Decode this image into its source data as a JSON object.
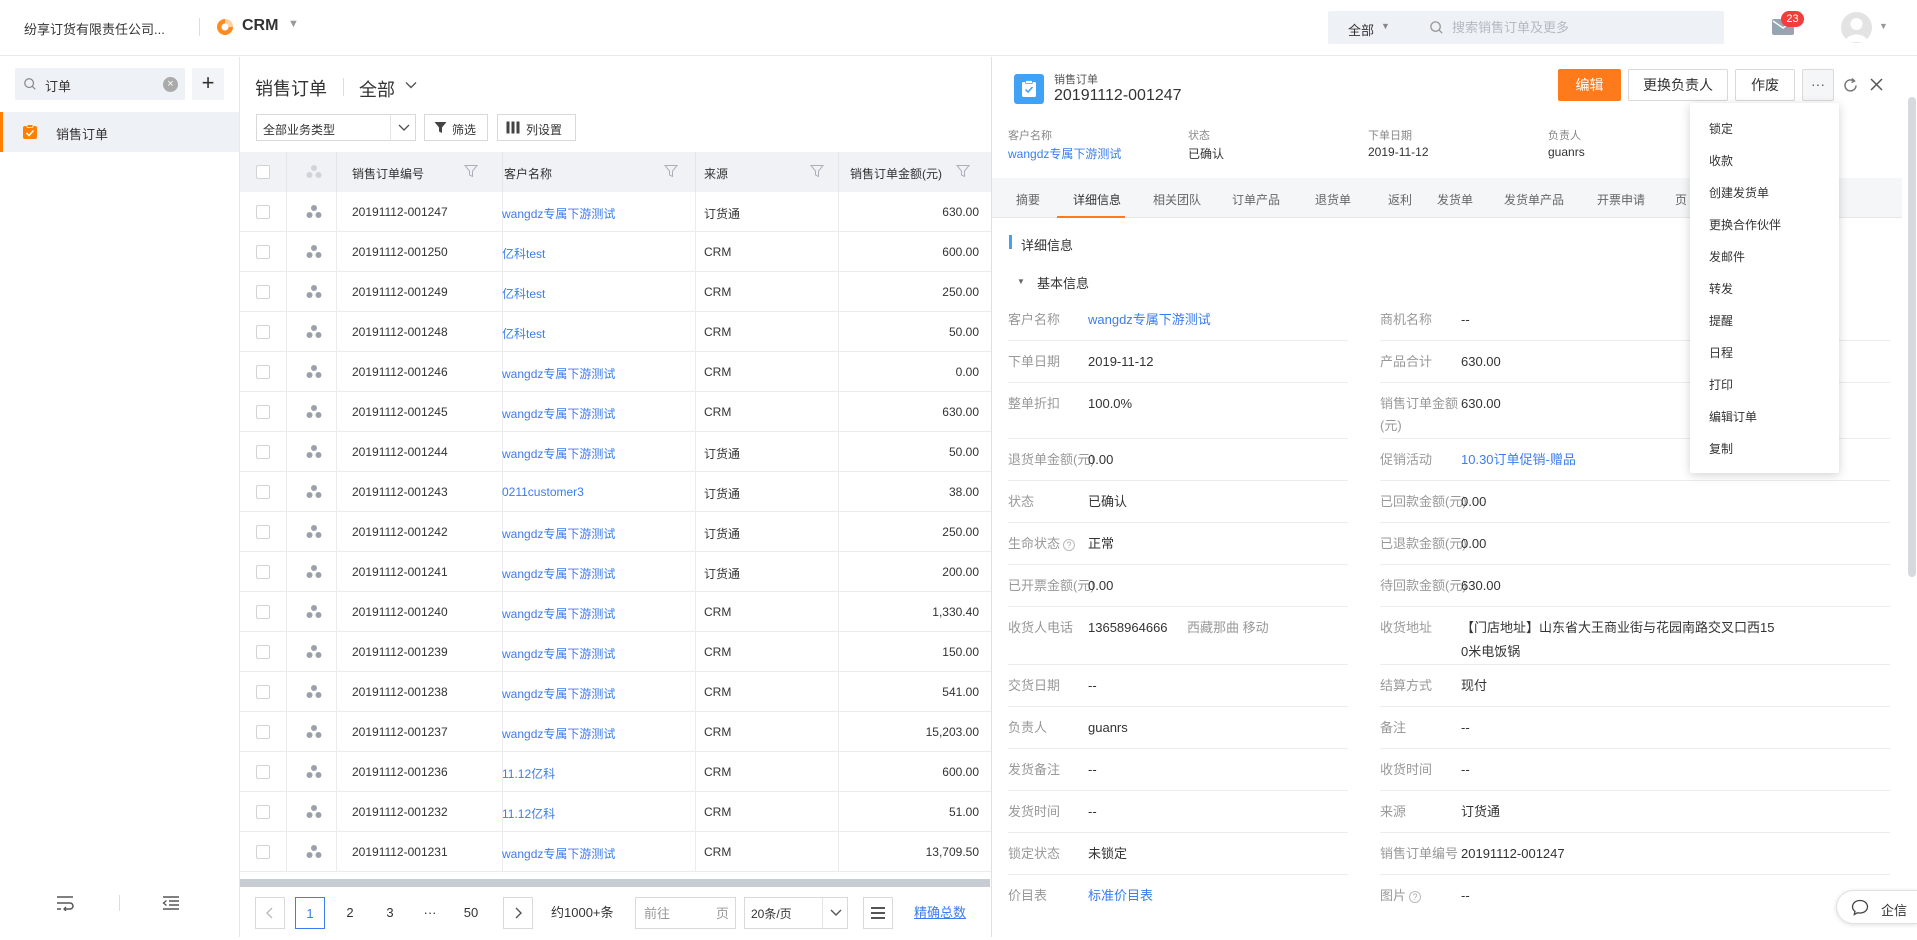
{
  "topbar": {
    "company": "纷享订货有限责任公司...",
    "app_name": "CRM",
    "search_scope": "全部",
    "search_placeholder": "搜索销售订单及更多",
    "mail_badge": "23"
  },
  "sidebar": {
    "search_value": "订单",
    "items": [
      {
        "label": "销售订单",
        "active": true
      }
    ]
  },
  "list": {
    "title": "销售订单",
    "scope": "全部",
    "biz_type": "全部业务类型",
    "filter_label": "筛选",
    "colset_label": "列设置",
    "columns": [
      "销售订单编号",
      "客户名称",
      "来源",
      "销售订单金额(元)"
    ],
    "rows": [
      {
        "no": "20191112-001247",
        "customer": "wangdz专属下游测试",
        "source": "订货通",
        "amount": "630.00"
      },
      {
        "no": "20191112-001250",
        "customer": "亿科test",
        "source": "CRM",
        "amount": "600.00"
      },
      {
        "no": "20191112-001249",
        "customer": "亿科test",
        "source": "CRM",
        "amount": "250.00"
      },
      {
        "no": "20191112-001248",
        "customer": "亿科test",
        "source": "CRM",
        "amount": "50.00"
      },
      {
        "no": "20191112-001246",
        "customer": "wangdz专属下游测试",
        "source": "CRM",
        "amount": "0.00"
      },
      {
        "no": "20191112-001245",
        "customer": "wangdz专属下游测试",
        "source": "CRM",
        "amount": "630.00"
      },
      {
        "no": "20191112-001244",
        "customer": "wangdz专属下游测试",
        "source": "订货通",
        "amount": "50.00"
      },
      {
        "no": "20191112-001243",
        "customer": "0211customer3",
        "source": "订货通",
        "amount": "38.00"
      },
      {
        "no": "20191112-001242",
        "customer": "wangdz专属下游测试",
        "source": "订货通",
        "amount": "250.00"
      },
      {
        "no": "20191112-001241",
        "customer": "wangdz专属下游测试",
        "source": "订货通",
        "amount": "200.00"
      },
      {
        "no": "20191112-001240",
        "customer": "wangdz专属下游测试",
        "source": "CRM",
        "amount": "1,330.40"
      },
      {
        "no": "20191112-001239",
        "customer": "wangdz专属下游测试",
        "source": "CRM",
        "amount": "150.00"
      },
      {
        "no": "20191112-001238",
        "customer": "wangdz专属下游测试",
        "source": "CRM",
        "amount": "541.00"
      },
      {
        "no": "20191112-001237",
        "customer": "wangdz专属下游测试",
        "source": "CRM",
        "amount": "15,203.00"
      },
      {
        "no": "20191112-001236",
        "customer": "11.12亿科",
        "source": "CRM",
        "amount": "600.00"
      },
      {
        "no": "20191112-001232",
        "customer": "11.12亿科",
        "source": "CRM",
        "amount": "51.00"
      },
      {
        "no": "20191112-001231",
        "customer": "wangdz专属下游测试",
        "source": "CRM",
        "amount": "13,709.50"
      }
    ],
    "pager": {
      "pages": [
        "1",
        "2",
        "3",
        "···",
        "50"
      ],
      "total": "约1000+条",
      "goto_placeholder": "前往",
      "goto_suffix": "页",
      "page_size": "20条/页",
      "exact_total": "精确总数"
    }
  },
  "detail": {
    "type": "销售订单",
    "number": "20191112-001247",
    "buttons": {
      "edit": "编辑",
      "change_owner": "更换负责人",
      "void": "作废",
      "more": "···"
    },
    "summary": [
      {
        "label": "客户名称",
        "value": "wangdz专属下游测试",
        "link": true
      },
      {
        "label": "状态",
        "value": "已确认"
      },
      {
        "label": "下单日期",
        "value": "2019-11-12"
      },
      {
        "label": "负责人",
        "value": "guanrs"
      }
    ],
    "tabs": [
      "摘要",
      "详细信息",
      "相关团队",
      "订单产品",
      "退货单",
      "返利",
      "发货单",
      "发货单产品",
      "开票申请",
      "页"
    ],
    "section_title": "详细信息",
    "group_title": "基本信息",
    "fields_left": [
      {
        "label": "客户名称",
        "value": "wangdz专属下游测试",
        "link": true
      },
      {
        "label": "下单日期",
        "value": "2019-11-12"
      },
      {
        "label": "整单折扣",
        "value": "100.0%"
      },
      {
        "label": "退货单金额(元)",
        "value": "0.00"
      },
      {
        "label": "状态",
        "value": "已确认"
      },
      {
        "label": "生命状态",
        "value": "正常",
        "help": "?"
      },
      {
        "label": "已开票金额(元)",
        "value": "0.00"
      },
      {
        "label": "收货人电话",
        "value": "13658964666",
        "extra": "西藏那曲 移动"
      },
      {
        "label": "交货日期",
        "value": "--"
      },
      {
        "label": "负责人",
        "value": "guanrs"
      },
      {
        "label": "发货备注",
        "value": "--"
      },
      {
        "label": "发货时间",
        "value": "--"
      },
      {
        "label": "锁定状态",
        "value": "未锁定"
      },
      {
        "label": "价目表",
        "value": "标准价目表",
        "link": true
      }
    ],
    "fields_right": [
      {
        "label": "商机名称",
        "value": "--"
      },
      {
        "label": "产品合计",
        "value": "630.00"
      },
      {
        "label": "销售订单金额",
        "label2": "(元)",
        "value": "630.00"
      },
      {
        "label": "促销活动",
        "value": "10.30订单促销-赠品",
        "link": true
      },
      {
        "label": "已回款金额(元)",
        "value": "0.00"
      },
      {
        "label": "已退款金额(元)",
        "value": "0.00"
      },
      {
        "label": "待回款金额(元)",
        "value": "630.00"
      },
      {
        "label": "收货地址",
        "value": "【门店地址】山东省大王商业街与花园南路交叉口西15",
        "value2": "0米电饭锅"
      },
      {
        "label": "结算方式",
        "value": "现付"
      },
      {
        "label": "备注",
        "value": "--"
      },
      {
        "label": "收货时间",
        "value": "--"
      },
      {
        "label": "来源",
        "value": "订货通"
      },
      {
        "label": "销售订单编号",
        "value": "20191112-001247"
      },
      {
        "label": "图片",
        "value": "--",
        "help": "?"
      }
    ]
  },
  "more_menu": [
    "锁定",
    "收款",
    "创建发货单",
    "更换合作伙伴",
    "发邮件",
    "转发",
    "提醒",
    "日程",
    "打印",
    "编辑订单",
    "复制"
  ],
  "chat_label": "企信",
  "colors": {
    "accent": "#ff7a1a",
    "link": "#3c7cf0",
    "badge": "#f23d3d",
    "icon_blue": "#3fa2f7"
  }
}
